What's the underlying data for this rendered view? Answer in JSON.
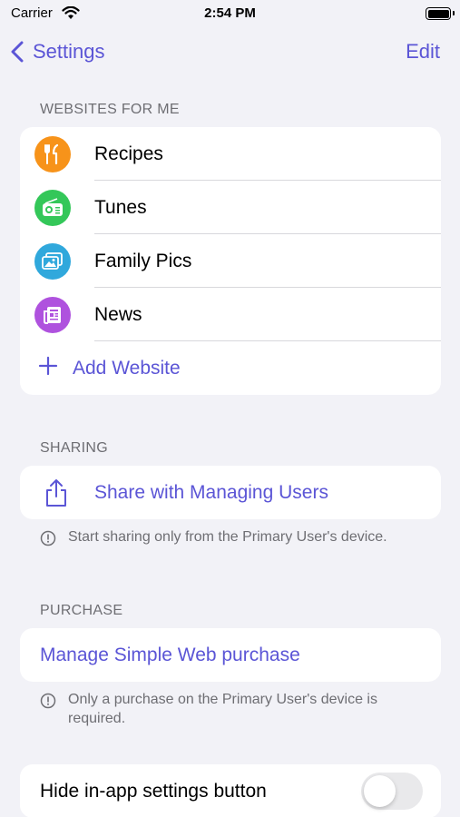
{
  "status_bar": {
    "carrier": "Carrier",
    "time": "2:54 PM"
  },
  "nav": {
    "back_label": "Settings",
    "edit_label": "Edit"
  },
  "websites": {
    "header": "WEBSITES FOR ME",
    "items": [
      {
        "label": "Recipes",
        "icon": "fork-knife-icon",
        "color": "#f7931a"
      },
      {
        "label": "Tunes",
        "icon": "radio-icon",
        "color": "#34c759"
      },
      {
        "label": "Family Pics",
        "icon": "photos-icon",
        "color": "#30a8dc"
      },
      {
        "label": "News",
        "icon": "newspaper-icon",
        "color": "#af52de"
      }
    ],
    "add_label": "Add Website"
  },
  "sharing": {
    "header": "SHARING",
    "action_label": "Share with Managing Users",
    "note": "Start sharing only from the Primary User's device."
  },
  "purchase": {
    "header": "PURCHASE",
    "action_label": "Manage Simple Web purchase",
    "note": "Only a purchase on the Primary User's device is required."
  },
  "settings_button": {
    "label": "Hide in-app settings button",
    "enabled": false
  },
  "colors": {
    "accent": "#5b55d6",
    "background": "#f2f2f7"
  }
}
